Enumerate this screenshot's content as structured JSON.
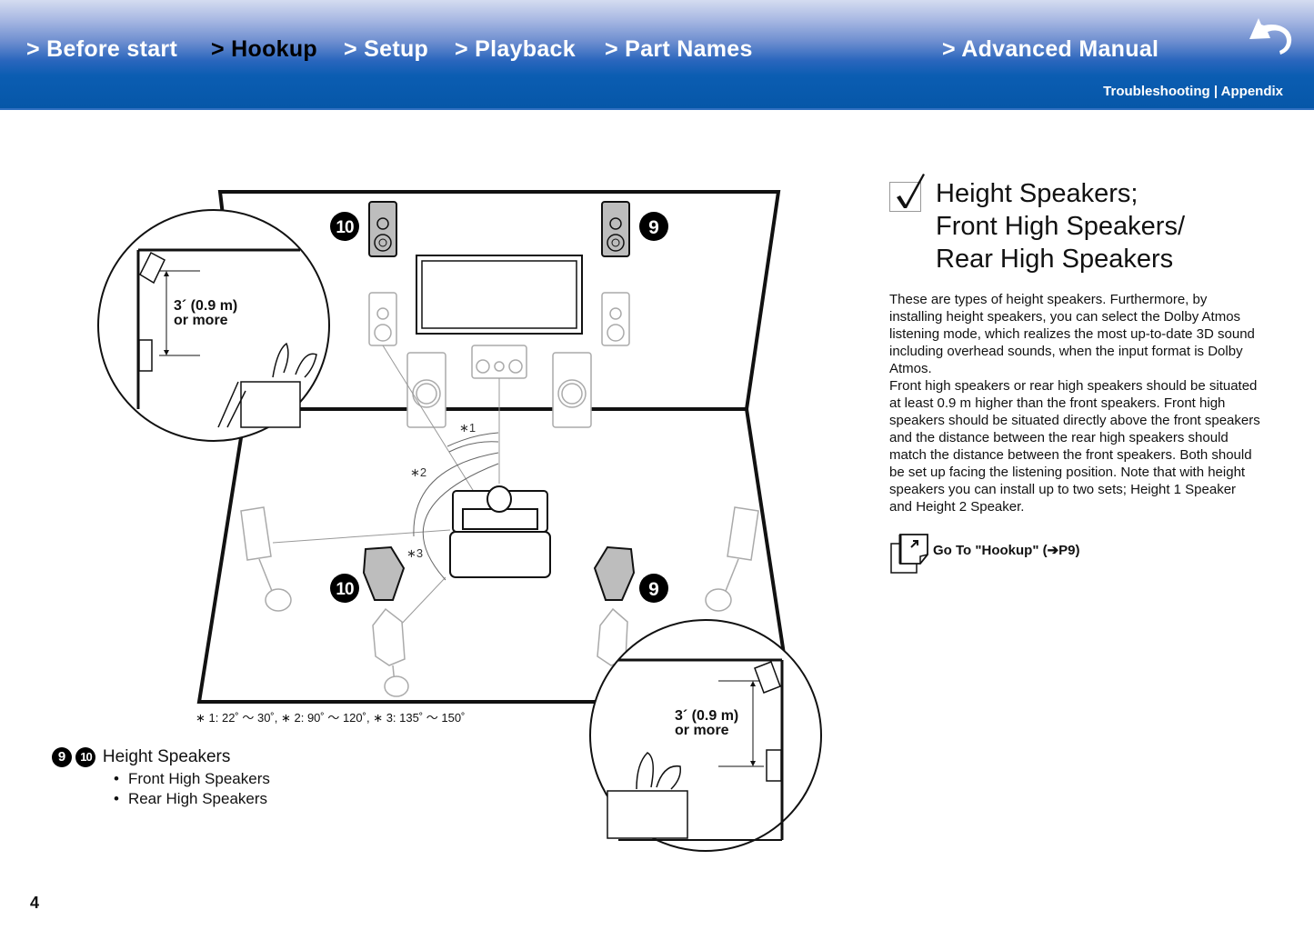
{
  "header": {
    "nav": [
      {
        "label": "> Before start",
        "active": false
      },
      {
        "label": "> Hookup",
        "active": true
      },
      {
        "label": "> Setup",
        "active": false
      },
      {
        "label": "> Playback",
        "active": false
      },
      {
        "label": "> Part Names",
        "active": false
      },
      {
        "label": "> Advanced Manual",
        "active": false
      }
    ],
    "subnav": {
      "troubleshooting": "Troubleshooting",
      "separator": " | ",
      "appendix": "Appendix"
    },
    "back_icon": "back-arrow-icon"
  },
  "diagram": {
    "callouts": {
      "front_high": "9",
      "rear_high": "10"
    },
    "left_inset": {
      "line1": "3´ (0.9 m)",
      "line2": "or more"
    },
    "right_inset": {
      "line1": "3´ (0.9 m)",
      "line2": "or more"
    },
    "angles": {
      "a1": "∗1",
      "a2": "∗2",
      "a3": "∗3"
    },
    "footnote": "∗ 1: 22˚ ～ 30˚, ∗ 2: 90˚ ～ 120˚, ∗ 3: 135˚ ～ 150˚"
  },
  "legend": {
    "badge_a": "9",
    "badge_b": "10",
    "title": "Height Speakers",
    "items": [
      "Front High Speakers",
      "Rear High Speakers"
    ]
  },
  "section": {
    "check_icon": "checkmark-icon",
    "heading": [
      "Height Speakers;",
      "Front High Speakers/",
      "Rear High Speakers"
    ],
    "body": "These are types of height speakers. Furthermore, by installing height speakers, you can select the Dolby Atmos listening mode, which realizes the most up-to-date 3D sound including overhead sounds, when the input format is Dolby Atmos.\nFront high speakers or rear high speakers should be situated at least 0.9 m higher than the front speakers. Front high speakers should be situated directly above the front speakers and the distance between the rear high speakers should match the distance between the front speakers. Both should be set up facing the listening position. Note that with height speakers you can install up to two sets; Height 1 Speaker and Height 2 Speaker.",
    "goto_label": "Go To \"Hookup\" (➔P9)"
  },
  "page_number": "4"
}
